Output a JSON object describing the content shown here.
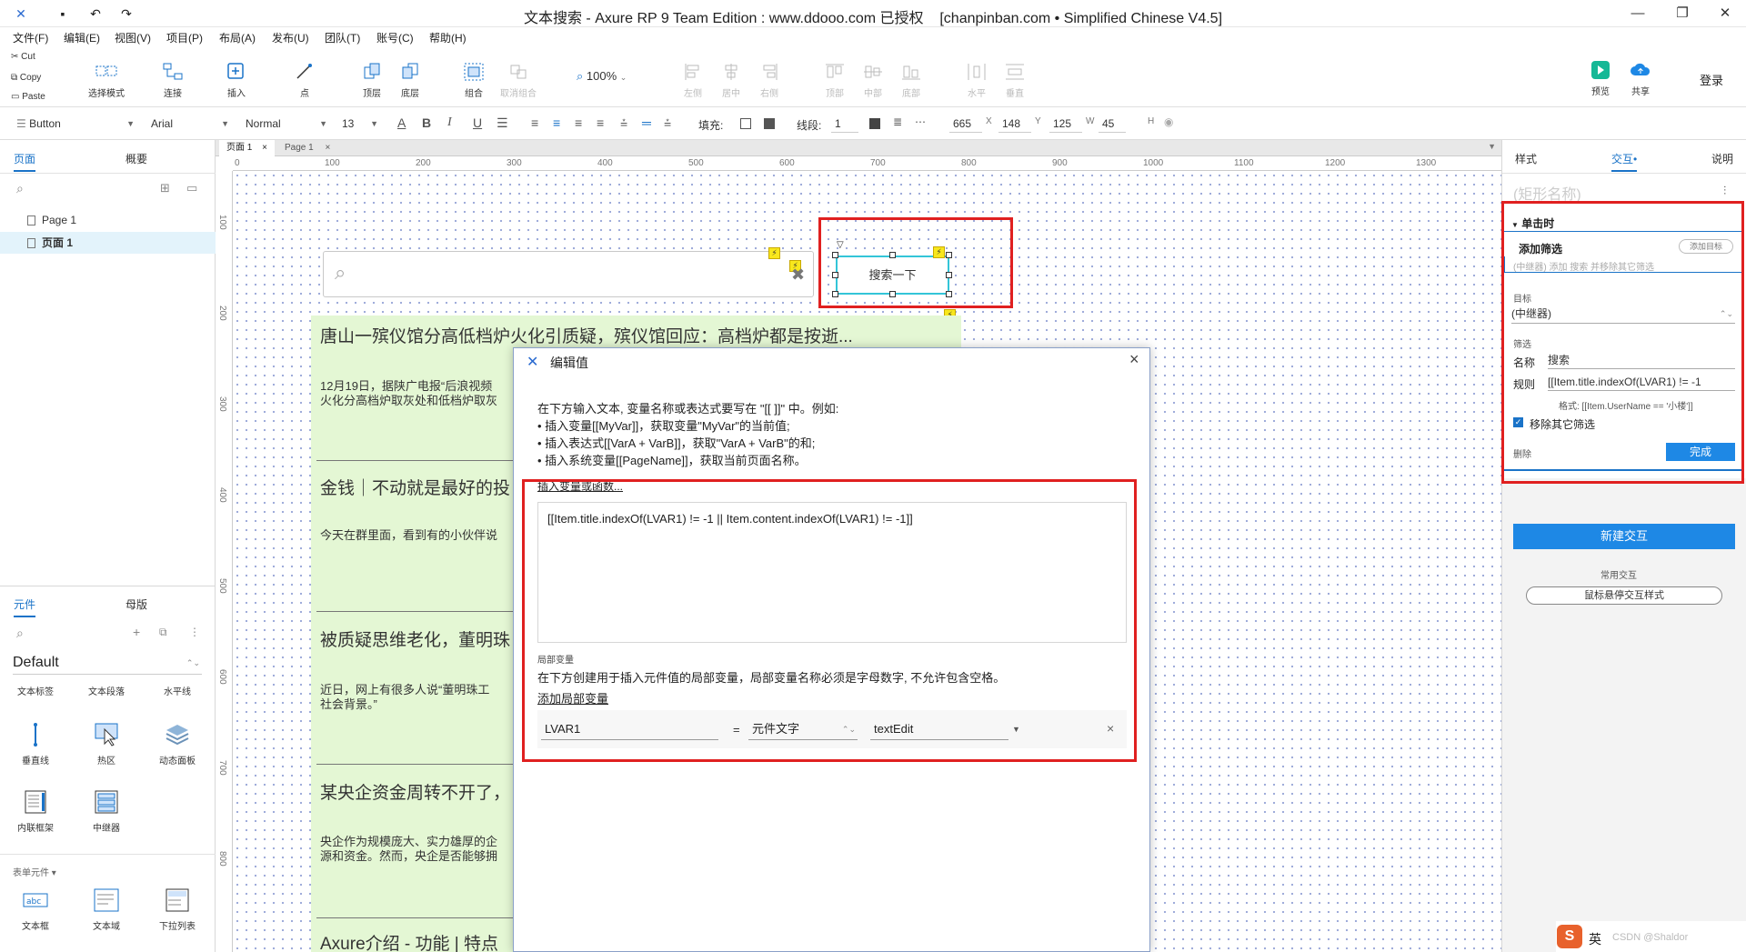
{
  "window": {
    "title": "文本搜索 - Axure RP 9 Team Edition : www.ddooo.com 已授权",
    "edition": "[chanpinban.com • Simplified Chinese V4.5]"
  },
  "menu": [
    "文件(F)",
    "编辑(E)",
    "视图(V)",
    "项目(P)",
    "布局(A)",
    "发布(U)",
    "团队(T)",
    "账号(C)",
    "帮助(H)"
  ],
  "clipboard": {
    "cut": "Cut",
    "copy": "Copy",
    "paste": "Paste"
  },
  "toolbar": {
    "select_mode": "选择模式",
    "connect": "连接",
    "insert": "插入",
    "point": "点",
    "top": "顶层",
    "bottom": "底层",
    "group": "组合",
    "ungroup": "取消组合",
    "zoom": "100%",
    "left": "左侧",
    "center": "居中",
    "right": "右侧",
    "top_align": "顶部",
    "middle": "中部",
    "bottom_align": "底部",
    "horizontal": "水平",
    "vertical": "垂直",
    "preview": "预览",
    "share": "共享",
    "login": "登录"
  },
  "format": {
    "widget_style": "Button",
    "font": "Arial",
    "weight": "Normal",
    "size": "13",
    "fill_label": "填充:",
    "line_label": "线段:",
    "line_width": "1",
    "x": "665",
    "x_label": "X",
    "y": "148",
    "y_label": "Y",
    "w": "125",
    "w_label": "W",
    "h": "45",
    "h_label": "H"
  },
  "left": {
    "tab_pages": "页面",
    "tab_overview": "概要",
    "pages": [
      "Page 1",
      "页面 1"
    ],
    "tab_widgets": "元件",
    "tab_masters": "母版",
    "library": "Default",
    "widgets": [
      "文本标签",
      "文本段落",
      "水平线",
      "垂直线",
      "热区",
      "动态面板",
      "内联框架",
      "中继器"
    ],
    "form_section": "表单元件",
    "form_widgets": [
      "文本框",
      "文本域",
      "下拉列表"
    ]
  },
  "doc_tabs": [
    "页面 1",
    "Page 1"
  ],
  "ruler_h": [
    "0",
    "100",
    "200",
    "300",
    "400",
    "500",
    "600",
    "700",
    "800",
    "900",
    "1000",
    "1100",
    "1200",
    "1300"
  ],
  "ruler_v": [
    "100",
    "200",
    "300",
    "400",
    "500",
    "600",
    "700",
    "800"
  ],
  "canvas": {
    "search_button": "搜索一下",
    "items": [
      {
        "title": "唐山一殡仪馆分高低档炉火化引质疑，殡仪馆回应：高档炉都是按逝...",
        "body": "12月19日，据陕广电报“后浪视频",
        "body2": "火化分高档炉取灰处和低档炉取灰"
      },
      {
        "title": "金钱｜不动就是最好的投",
        "body": "今天在群里面，看到有的小伙伴说",
        "body2": ""
      },
      {
        "title": "被质疑思维老化，董明珠",
        "body": "近日，网上有很多人说“董明珠工",
        "body2": "社会背景。”"
      },
      {
        "title": "某央企资金周转不开了，",
        "body": "央企作为规模庞大、实力雄厚的企",
        "body2": "源和资金。然而，央企是否能够拥"
      },
      {
        "title": "Axure介绍 - 功能 | 特点",
        "body": "",
        "body2": ""
      }
    ]
  },
  "dialog": {
    "title": "编辑值",
    "intro": "在下方输入文本, 变量名称或表达式要写在 \"[[ ]]\" 中。例如:",
    "line1": "• 插入变量[[MyVar]]，获取变量\"MyVar\"的当前值;",
    "line2": "• 插入表达式[[VarA + VarB]]，获取\"VarA + VarB\"的和;",
    "line3": "• 插入系统变量[[PageName]]，获取当前页面名称。",
    "insert_link": "插入变量或函数...",
    "expression": "[[Item.title.indexOf(LVAR1) != -1 || Item.content.indexOf(LVAR1) != -1]]",
    "local_title": "局部变量",
    "local_desc": "在下方创建用于插入元件值的局部变量，局部变量名称必须是字母数字, 不允许包含空格。",
    "add_local": "添加局部变量",
    "var_name": "LVAR1",
    "equals": "=",
    "var_type": "元件文字",
    "var_target": "textEdit"
  },
  "right": {
    "tab_style": "样式",
    "tab_interact": "交互",
    "tab_notes": "说明",
    "shape_name_placeholder": "(矩形名称)",
    "event": "单击时",
    "action": "添加筛选",
    "add_target": "添加目标",
    "summary": "(中继器) 添加 搜索 并移除其它筛选",
    "target_label": "目标",
    "target_value": "(中继器)",
    "filter_label": "筛选",
    "name_label": "名称",
    "name_value": "搜索",
    "rule_label": "规则",
    "rule_value": "[[Item.title.indexOf(LVAR1) != -1",
    "format_hint": "格式:  [[Item.UserName == '小楼']]",
    "remove_others": "移除其它筛选",
    "delete": "删除",
    "done": "完成",
    "new_interaction": "新建交互",
    "common": "常用交互",
    "hover_style": "鼠标悬停交互样式"
  },
  "badge": {
    "ime": "英",
    "watermark": "CSDN @Shaldor"
  },
  "colors": {
    "accent": "#1e88e5",
    "highlight": "#e02020",
    "repeater_bg": "#e4f7d4",
    "selection": "#33c5d8"
  }
}
